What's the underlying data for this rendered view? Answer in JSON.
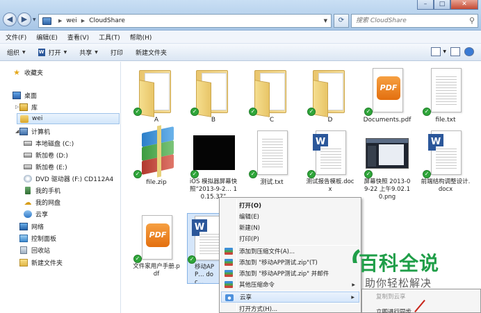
{
  "window": {
    "path": [
      "wei",
      "CloudShare"
    ],
    "search_placeholder": "搜索 CloudShare"
  },
  "menubar": [
    "文件(F)",
    "编辑(E)",
    "查看(V)",
    "工具(T)",
    "帮助(H)"
  ],
  "toolbar": {
    "organize": "组织",
    "open": "打开",
    "share": "共享",
    "print": "打印",
    "new_folder": "新建文件夹"
  },
  "sidebar": {
    "favorites": "收藏夹",
    "desktop": "桌面",
    "library": "库",
    "user": "wei",
    "computer": "计算机",
    "drives": [
      "本地磁盘 (C:)",
      "新加卷 (D:)",
      "新加卷 (E:)",
      "DVD 驱动器 (F:) CD112A4",
      "我的手机",
      "我的网盘",
      "云享"
    ],
    "network": "网络",
    "control_panel": "控制面板",
    "recycle_bin": "回收站",
    "new_folder": "新建文件夹"
  },
  "files": [
    {
      "name": "A",
      "type": "folder"
    },
    {
      "name": "B",
      "type": "folder"
    },
    {
      "name": "C",
      "type": "folder"
    },
    {
      "name": "D",
      "type": "folder"
    },
    {
      "name": "Documents.pdf",
      "type": "pdf"
    },
    {
      "name": "file.txt",
      "type": "txt"
    },
    {
      "name": "file.zip",
      "type": "zip"
    },
    {
      "name": "iOS 模拟器屏幕快照“2013-9-2… 10.15.37”",
      "type": "image-black"
    },
    {
      "name": "测试.txt",
      "type": "txt"
    },
    {
      "name": "测试报告模板.docx",
      "type": "word"
    },
    {
      "name": "屏幕快照 2013-09-22 上午9.02.10.png",
      "type": "image-shot"
    },
    {
      "name": "前端结构调整设计.docx",
      "type": "word"
    },
    {
      "name": "文件家用户手册.pdf",
      "type": "pdf"
    },
    {
      "name": "移动APP… doc…",
      "type": "word"
    }
  ],
  "context_menu": {
    "items": [
      "打开(O)",
      "编辑(E)",
      "新建(N)",
      "打印(P)",
      "添加到压缩文件(A)...",
      "添加到 \"移动APP测试.zip\"(T)",
      "添加到 \"移动APP测试.zip\" 并邮件",
      "其他压缩命令",
      "云享",
      "打开方式(H)..."
    ],
    "submenu": [
      "复制到云享",
      "立即进行同步"
    ]
  },
  "watermark": {
    "brand": "百科全说",
    "tagline": "助你轻松解决"
  },
  "colors": {
    "checkmark": "#2fa63a",
    "brand_green": "#1f9e48",
    "pdf_orange": "#e36f0f",
    "word_blue": "#2b579a"
  }
}
